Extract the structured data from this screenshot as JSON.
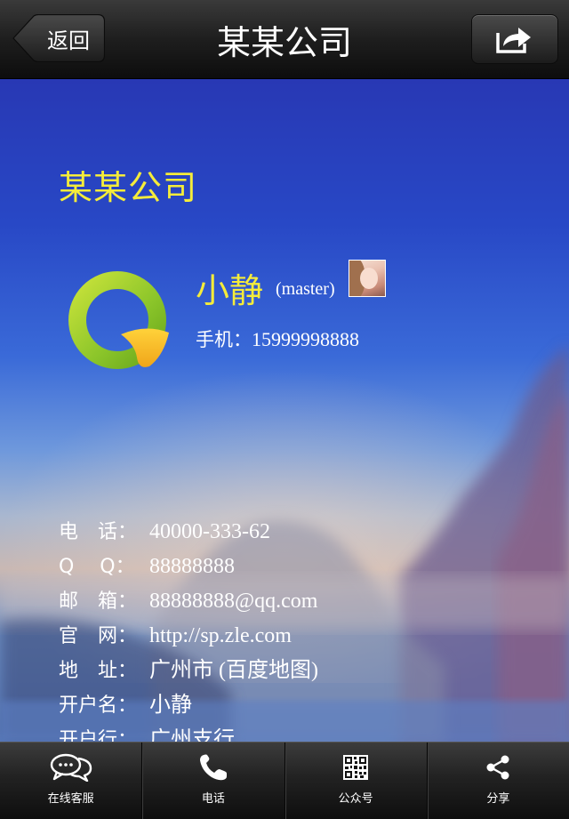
{
  "navbar": {
    "back_label": "返回",
    "title": "某某公司",
    "share_icon": "share-icon"
  },
  "card": {
    "company_name": "某某公司",
    "logo_icon": "q-logo",
    "person": {
      "name": "小静",
      "role": "(master)",
      "mobile_label": "手机：",
      "mobile": "15999998888"
    },
    "info": [
      {
        "label": "电　话：",
        "value": "40000-333-62"
      },
      {
        "label": "Q　  Q：",
        "value": "88888888"
      },
      {
        "label": "邮　箱：",
        "value": "88888888@qq.com"
      },
      {
        "label": "官　网：",
        "value": "http://sp.zle.com"
      },
      {
        "label": "地　址：",
        "value": "广州市 (百度地图)"
      },
      {
        "label": "开户名：",
        "value": "小静"
      },
      {
        "label": "开户行：",
        "value": "广州支行"
      }
    ]
  },
  "tabbar": {
    "items": [
      {
        "label": "在线客服",
        "icon": "chat-bubbles-icon"
      },
      {
        "label": "电话",
        "icon": "phone-icon"
      },
      {
        "label": "公众号",
        "icon": "qr-code-icon"
      },
      {
        "label": "分享",
        "icon": "share-nodes-icon"
      }
    ]
  },
  "colors": {
    "accent_yellow": "#f5ec3a",
    "sky_blue": "#2a49c8",
    "bar_dark": "#1e1e1e"
  }
}
